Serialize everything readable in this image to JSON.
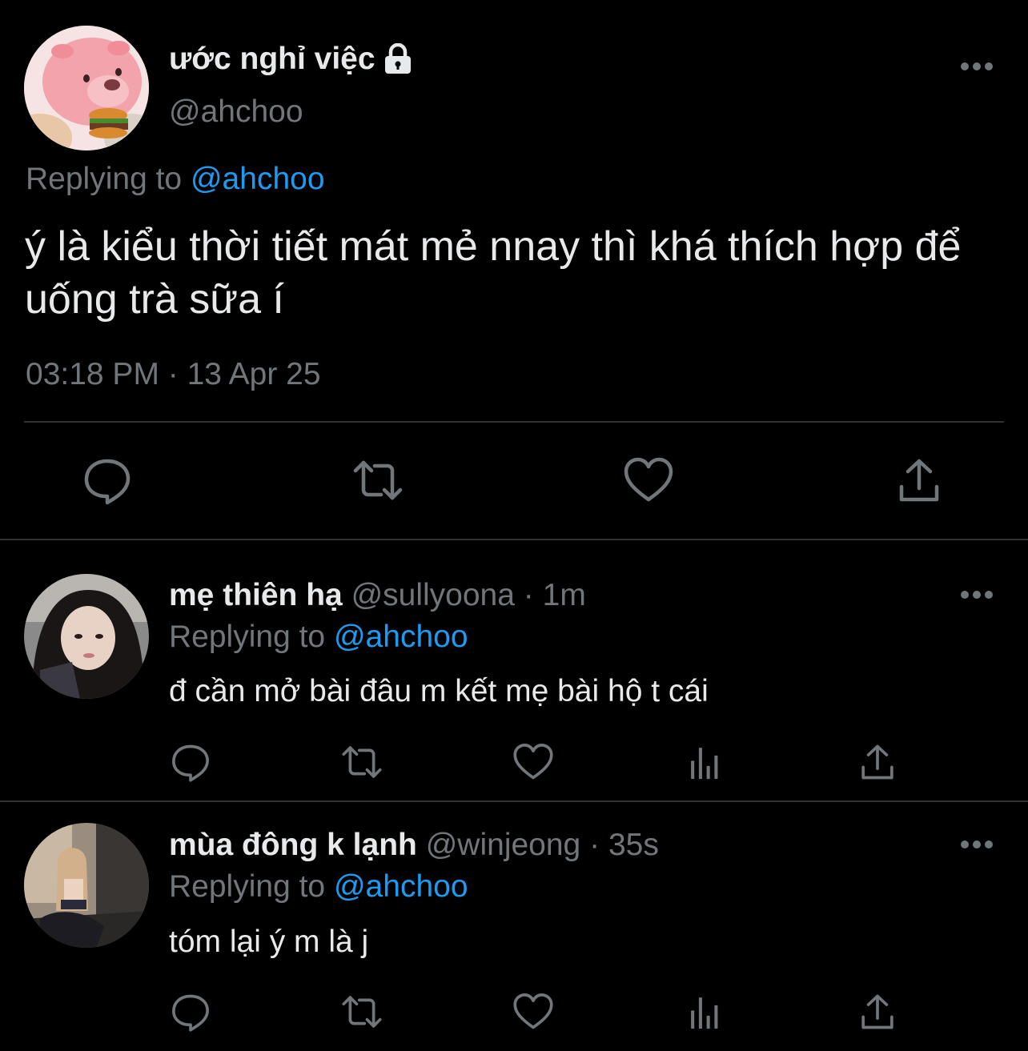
{
  "main_tweet": {
    "display_name": "ước nghỉ việc",
    "handle": "@ahchoo",
    "replying_prefix": "Replying to",
    "replying_to": "@ahchoo",
    "text": "ý là kiểu thời tiết mát mẻ nnay thì khá thích hợp để uống trà sữa í",
    "timestamp": "03:18 PM · 13 Apr 25",
    "actions": [
      "reply-icon",
      "retweet-icon",
      "like-icon",
      "share-icon"
    ]
  },
  "replies": [
    {
      "display_name": "mẹ thiên hạ",
      "handle": "@sullyoona",
      "dot": "·",
      "time": "1m",
      "replying_prefix": "Replying to",
      "replying_to": "@ahchoo",
      "text": "đ cần mở bài đâu m kết mẹ bài hộ t cái",
      "actions": [
        "reply-icon",
        "retweet-icon",
        "like-icon",
        "analytics-icon",
        "share-icon"
      ]
    },
    {
      "display_name": "mùa đông k lạnh",
      "handle": "@winjeong",
      "dot": "·",
      "time": "35s",
      "replying_prefix": "Replying to",
      "replying_to": "@ahchoo",
      "text": "tóm lại ý m là j",
      "actions": [
        "reply-icon",
        "retweet-icon",
        "like-icon",
        "analytics-icon",
        "share-icon"
      ]
    }
  ],
  "colors": {
    "background": "#000000",
    "text": "#e7e9ea",
    "muted": "#71767b",
    "accent": "#1d9bf0",
    "divider": "#2f3336"
  }
}
